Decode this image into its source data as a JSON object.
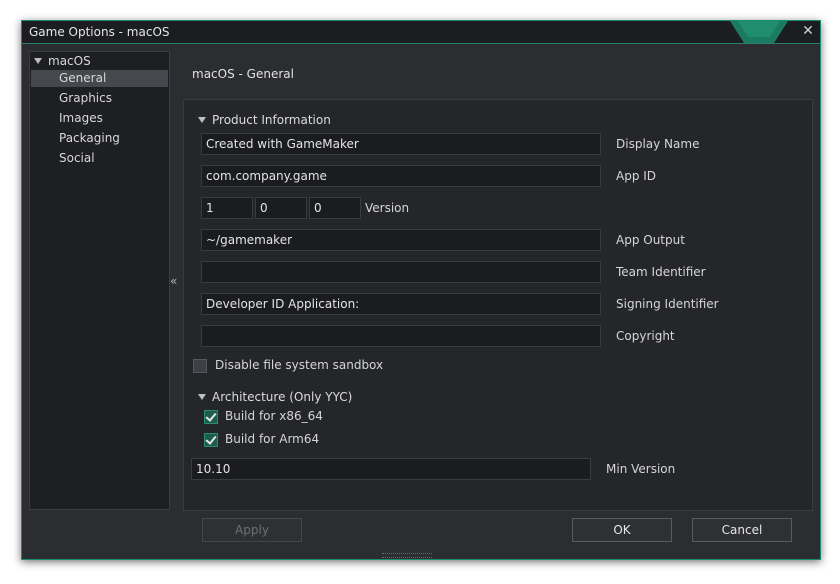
{
  "window": {
    "title": "Game Options - macOS",
    "accent": "#1b8b6f"
  },
  "tree": {
    "root": "macOS",
    "items": [
      {
        "label": "General",
        "selected": true
      },
      {
        "label": "Graphics",
        "selected": false
      },
      {
        "label": "Images",
        "selected": false
      },
      {
        "label": "Packaging",
        "selected": false
      },
      {
        "label": "Social",
        "selected": false
      }
    ]
  },
  "header": "macOS - General",
  "product_info": {
    "title": "Product Information",
    "display_name": {
      "value": "Created with GameMaker",
      "label": "Display Name"
    },
    "app_id": {
      "value": "com.company.game",
      "label": "App ID"
    },
    "version": {
      "major": "1",
      "minor": "0",
      "build": "0",
      "label": "Version"
    },
    "app_output": {
      "value": "~/gamemaker",
      "label": "App Output"
    },
    "team_identifier": {
      "value": "",
      "label": "Team Identifier"
    },
    "signing_identifier": {
      "value": "Developer ID Application:",
      "label": "Signing Identifier"
    },
    "copyright": {
      "value": "",
      "label": "Copyright"
    }
  },
  "sandbox": {
    "label": "Disable file system sandbox",
    "checked": false
  },
  "architecture": {
    "title": "Architecture (Only YYC)",
    "x86": {
      "label": "Build for x86_64",
      "checked": true
    },
    "arm": {
      "label": "Build for Arm64",
      "checked": true
    }
  },
  "min_version": {
    "value": "10.10",
    "label": "Min Version"
  },
  "buttons": {
    "apply": "Apply",
    "ok": "OK",
    "cancel": "Cancel"
  }
}
